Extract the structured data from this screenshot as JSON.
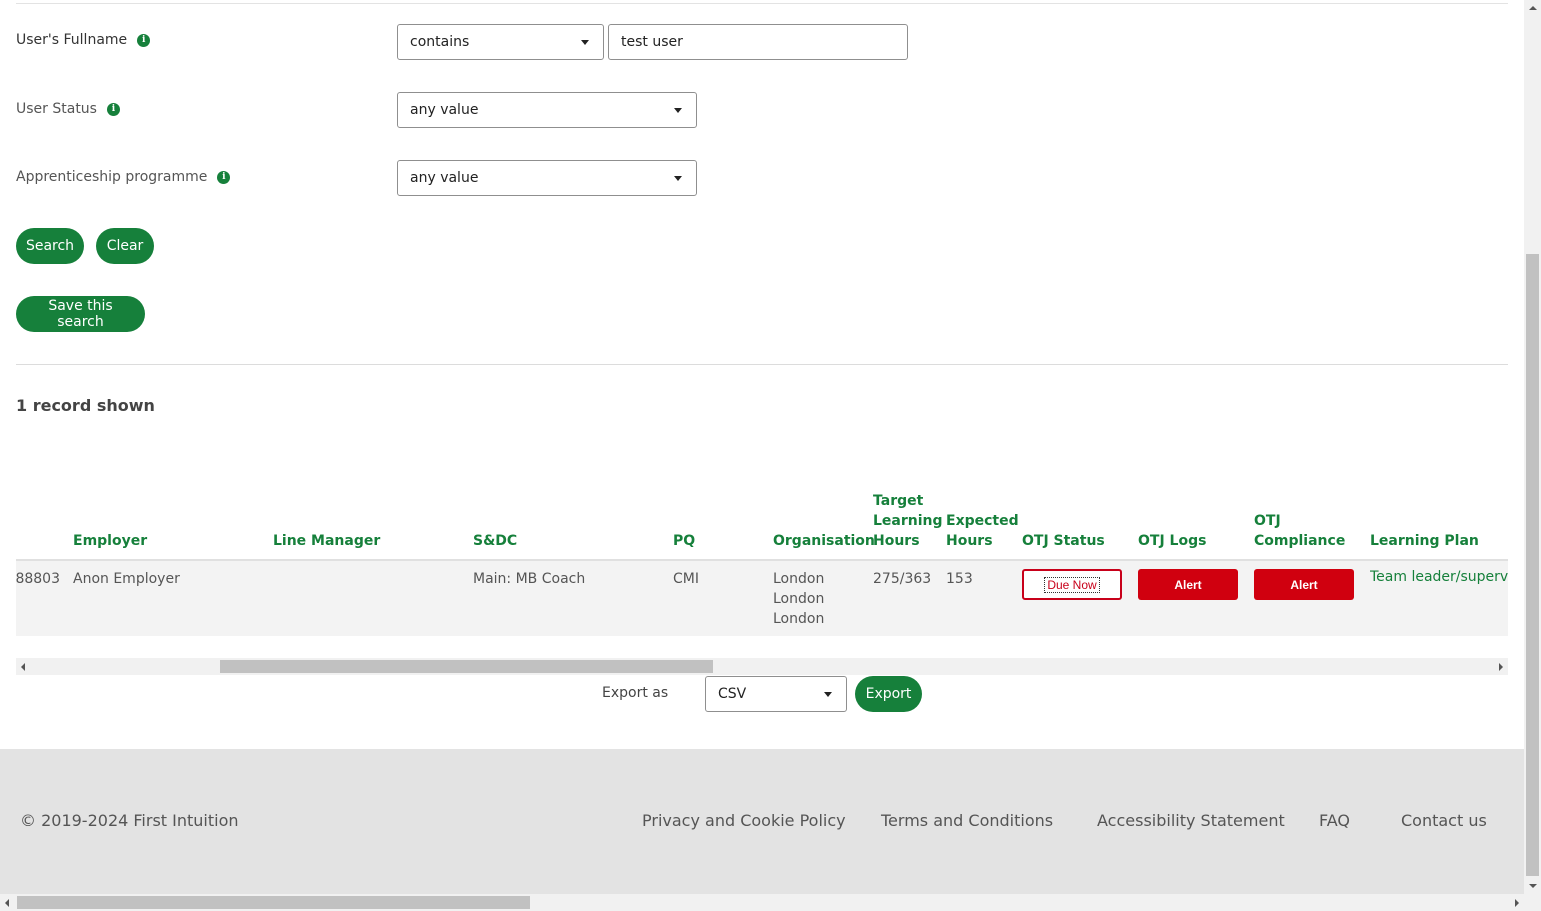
{
  "filters": {
    "fullname": {
      "label": "User's Fullname",
      "operator": "contains",
      "value": "test user"
    },
    "status": {
      "label": "User Status",
      "value": "any value"
    },
    "programme": {
      "label": "Apprenticeship programme",
      "value": "any value"
    }
  },
  "buttons": {
    "search": "Search",
    "clear": "Clear",
    "save_search": "Save this search"
  },
  "records_shown": "1 record shown",
  "table": {
    "headers": {
      "employer": "Employer",
      "line_manager": "Line Manager",
      "sdc": "S&DC",
      "pq": "PQ",
      "organisation": "Organisation",
      "target_hours": [
        "Target",
        "Learning",
        "Hours"
      ],
      "expected_hours": [
        "Expected",
        "Hours"
      ],
      "otj_status": "OTJ Status",
      "otj_logs": "OTJ Logs",
      "otj_compliance": [
        "OTJ",
        "Compliance"
      ],
      "learning_plan": "Learning Plan"
    },
    "row": {
      "id_fragment": "88803",
      "employer": "Anon Employer",
      "line_manager": "",
      "sdc": "Main: MB Coach",
      "pq": "CMI",
      "organisation": [
        "London",
        "London",
        "London"
      ],
      "target_hours": "275/363",
      "expected_hours": "153",
      "otj_status": "Due Now",
      "otj_logs": "Alert",
      "otj_compliance": "Alert",
      "learning_plan": "Team leader/supervisor"
    }
  },
  "export": {
    "label": "Export as",
    "format": "CSV",
    "button": "Export"
  },
  "footer": {
    "copyright": "© 2019-2024 First Intuition",
    "links": [
      "Privacy and Cookie Policy",
      "Terms and Conditions",
      "Accessibility Statement",
      "FAQ",
      "Contact us"
    ]
  },
  "colors": {
    "accent": "#16803b",
    "alert": "#d0000f"
  }
}
